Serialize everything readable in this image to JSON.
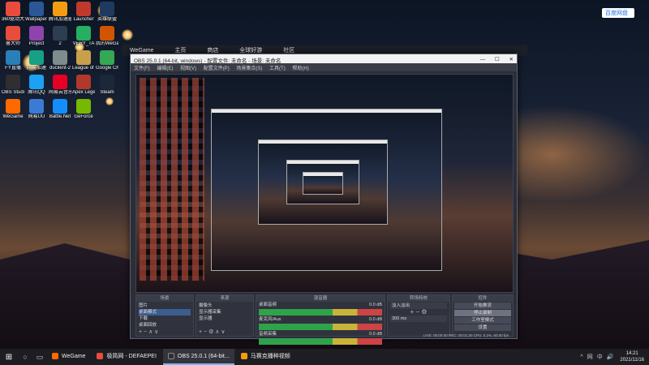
{
  "desktop": {
    "icons": [
      {
        "label": "360驱动大师绿色版",
        "color": "#e84c3d"
      },
      {
        "label": "Wallpaper Engine",
        "color": "#2b5797"
      },
      {
        "label": "腾讯加速器",
        "color": "#f39c12"
      },
      {
        "label": "Launcher",
        "color": "#c0392b"
      },
      {
        "label": "英雄联盟",
        "color": "#1e3a5f"
      },
      {
        "label": "魯大师",
        "color": "#e74c3c"
      },
      {
        "label": "Project",
        "color": "#8e44ad"
      },
      {
        "label": "2",
        "color": "#2c3e50"
      },
      {
        "label": "VERY_TA",
        "color": "#27ae60"
      },
      {
        "label": "我的WeGame",
        "color": "#d35400"
      },
      {
        "label": "FY直播",
        "color": "#2980b9"
      },
      {
        "label": "网易加速",
        "color": "#16a085"
      },
      {
        "label": "ducilent-2",
        "color": "#7f8c8d"
      },
      {
        "label": "League of Legends",
        "color": "#c9a04a"
      },
      {
        "label": "Google Chrome",
        "color": "#34a853"
      },
      {
        "label": "OBS Studio",
        "color": "#302e31"
      },
      {
        "label": "腾讯QQ",
        "color": "#1da1f2"
      },
      {
        "label": "网易云音乐",
        "color": "#e60026"
      },
      {
        "label": "Apex Legends",
        "color": "#b0392b"
      },
      {
        "label": "Steam",
        "color": "#1b2838"
      },
      {
        "label": "WeGame",
        "color": "#ff6a00"
      },
      {
        "label": "网易UU",
        "color": "#3a7bd5"
      },
      {
        "label": "Battle.Net",
        "color": "#148eff"
      },
      {
        "label": "GeForce",
        "color": "#76b900"
      }
    ]
  },
  "wegame_window": {
    "title": "WeGame",
    "tabs": [
      "主页",
      "商店",
      "全球好游",
      "社区"
    ]
  },
  "top_right_widget": {
    "label": "百度网盘"
  },
  "obs": {
    "title": "OBS 25.0.1 (64-bit, windows) - 配置文件: 未命名 - 场景: 未命名",
    "menu": [
      "文件(F)",
      "编辑(E)",
      "视图(V)",
      "配置文件(P)",
      "场景集合(S)",
      "工具(T)",
      "帮助(H)"
    ],
    "docks": {
      "scenes": {
        "header": "场景",
        "items": [
          "图片",
          "桌面模式",
          "下载",
          "桌面回放"
        ],
        "selected_index": 1
      },
      "sources": {
        "header": "来源",
        "items": [
          "摄像头",
          "显示器采集",
          "显示器"
        ]
      },
      "mixer": {
        "header": "混音器",
        "channels": [
          {
            "name": "桌面音频",
            "db": "0.0 dB"
          },
          {
            "name": "麦克风/Aux",
            "db": "0.0 dB"
          },
          {
            "name": "音频采集",
            "db": "0.0 dB"
          }
        ]
      },
      "transitions": {
        "header": "转场特效",
        "current": "淡入淡出",
        "duration": "300 ms"
      },
      "controls": {
        "header": "控件",
        "buttons": [
          "开始推流",
          "停止录制",
          "工作室模式",
          "设置",
          "退出"
        ],
        "active_index": 1
      }
    },
    "status": "LIVE: 00:00:00   REC: 00:01:30   CPU: 5.2%, 60.00 fps"
  },
  "taskbar": {
    "apps": [
      {
        "label": "WeGame",
        "color": "#ff6a00",
        "active": false
      },
      {
        "label": "极简网 - DEFAEPEI",
        "color": "#e84c3d",
        "active": false
      },
      {
        "label": "OBS 25.0.1 (64-bit...",
        "color": "#302e31",
        "active": true
      },
      {
        "label": "马赛克播种视频",
        "color": "#f39c12",
        "active": false
      }
    ],
    "tray_icons": [
      "^",
      "网",
      "中",
      "🔊"
    ],
    "time": "14:21",
    "date": "2021/11/16"
  }
}
